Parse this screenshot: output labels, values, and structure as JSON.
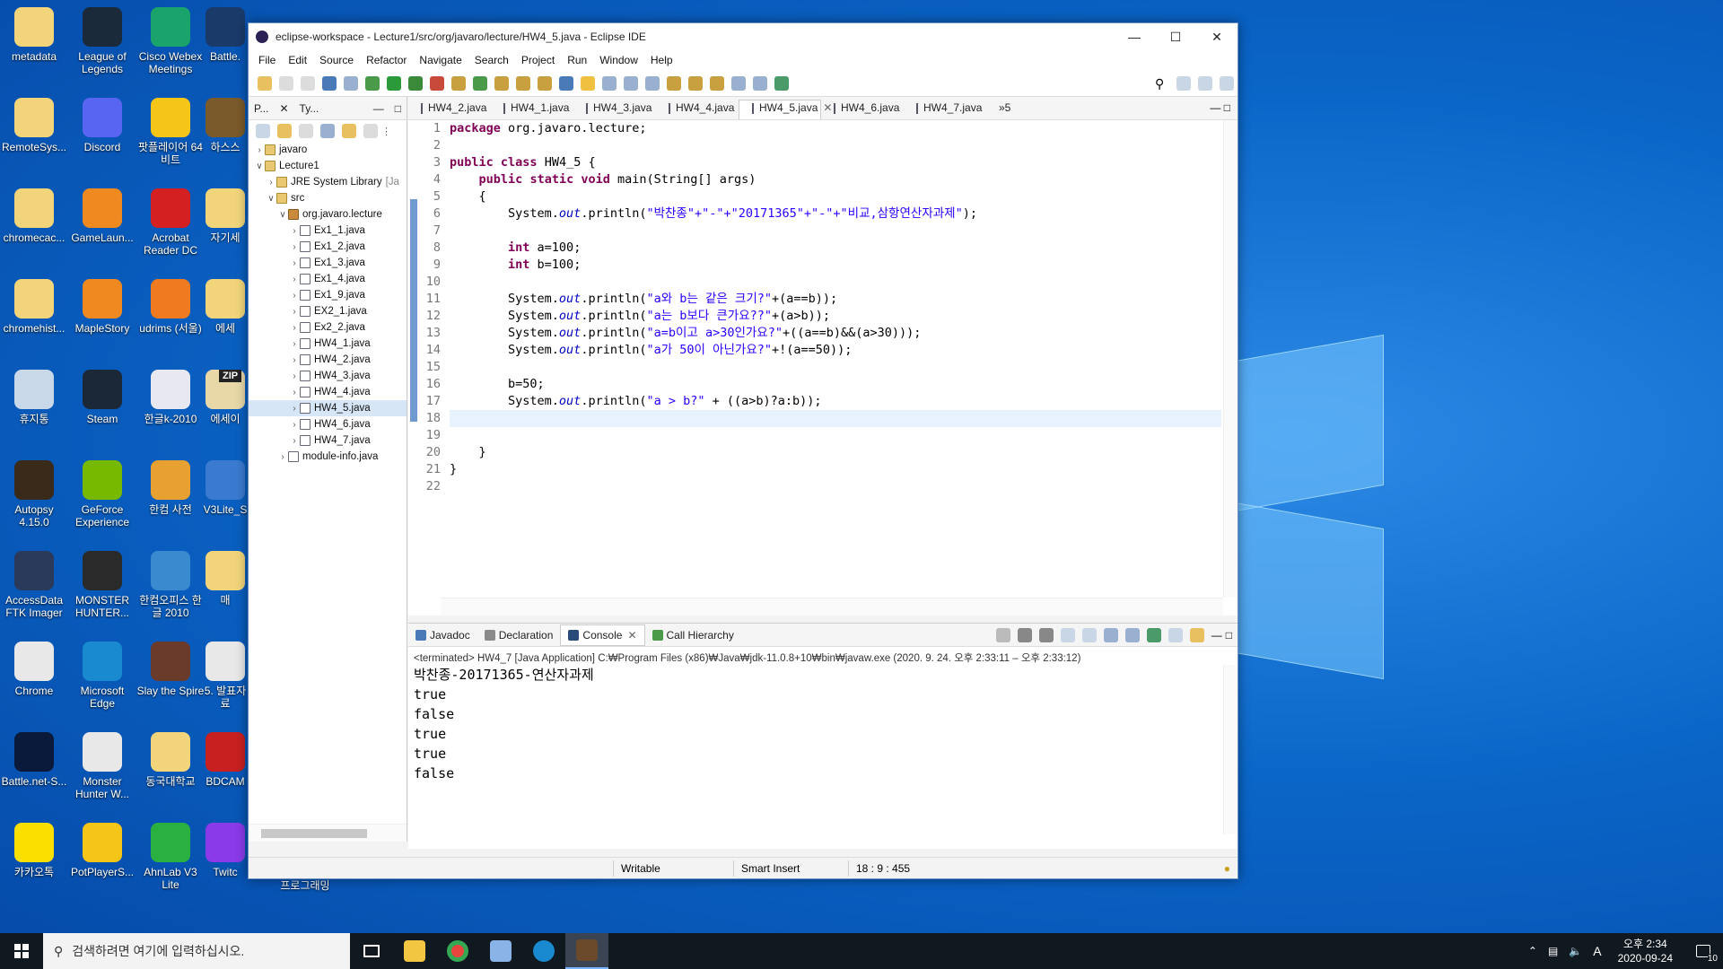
{
  "desktop": {
    "icons": [
      {
        "label": "metadata",
        "color": "#f2d57a"
      },
      {
        "label": "League of Legends",
        "color": "#1b2a3a"
      },
      {
        "label": "Cisco Webex Meetings",
        "color": "#1aa36a"
      },
      {
        "label": "Battle.",
        "color": "#1a3a6a"
      },
      {
        "label": "RemoteSys...",
        "color": "#f2d57a"
      },
      {
        "label": "Discord",
        "color": "#5865f2"
      },
      {
        "label": "팟플레이어 64 비트",
        "color": "#f5c518"
      },
      {
        "label": "하스스",
        "color": "#7a5a2a"
      },
      {
        "label": "chromecac...",
        "color": "#f2d57a"
      },
      {
        "label": "GameLaun...",
        "color": "#f08a20"
      },
      {
        "label": "Acrobat Reader DC",
        "color": "#d42020"
      },
      {
        "label": "자기세",
        "color": "#f2d57a"
      },
      {
        "label": "chromehist...",
        "color": "#f2d57a"
      },
      {
        "label": "MapleStory",
        "color": "#f08a20"
      },
      {
        "label": "udrims (서울)",
        "color": "#f07a20"
      },
      {
        "label": "에세",
        "color": "#f2d57a"
      },
      {
        "label": "휴지통",
        "color": "#c8d8e8"
      },
      {
        "label": "Steam",
        "color": "#1b2838"
      },
      {
        "label": "한글k-2010",
        "color": "#e8e8f0"
      },
      {
        "label": "에세이",
        "color": "#e8d8a8"
      },
      {
        "label": "Autopsy 4.15.0",
        "color": "#3a2a1a"
      },
      {
        "label": "GeForce Experience",
        "color": "#76b900"
      },
      {
        "label": "한컴 사전",
        "color": "#e8a030"
      },
      {
        "label": "V3Lite_S",
        "color": "#3a7ad0"
      },
      {
        "label": "AccessData FTK Imager",
        "color": "#2a3a5a"
      },
      {
        "label": "MONSTER HUNTER...",
        "color": "#2a2a2a"
      },
      {
        "label": "한컴오피스 한글 2010",
        "color": "#3a8ad0"
      },
      {
        "label": "매",
        "color": "#f2d57a"
      },
      {
        "label": "Chrome",
        "color": "#e8e8e8"
      },
      {
        "label": "Microsoft Edge",
        "color": "#1a8ad0"
      },
      {
        "label": "Slay the Spire",
        "color": "#6a3a2a"
      },
      {
        "label": "5. 발표자료",
        "color": "#e8e8e8"
      },
      {
        "label": "Battle.net-S...",
        "color": "#0a1a3a"
      },
      {
        "label": "Monster Hunter W...",
        "color": "#e8e8e8"
      },
      {
        "label": "동국대학교",
        "color": "#f2d57a"
      },
      {
        "label": "BDCAM",
        "color": "#c82020"
      },
      {
        "label": "카카오톡",
        "color": "#f9e000"
      },
      {
        "label": "PotPlayerS...",
        "color": "#f5c518"
      },
      {
        "label": "AhnLab V3 Lite",
        "color": "#2ab040"
      },
      {
        "label": "Twitc",
        "color": "#8a3ae8"
      }
    ],
    "zip_badge": "ZIP",
    "extra_label": "프로그래밍"
  },
  "window": {
    "title": "eclipse-workspace - Lecture1/src/org/javaro/lecture/HW4_5.java - Eclipse IDE",
    "menu": [
      "File",
      "Edit",
      "Source",
      "Refactor",
      "Navigate",
      "Search",
      "Project",
      "Run",
      "Window",
      "Help"
    ]
  },
  "left_pane": {
    "tabs": [
      "P...",
      "Ty..."
    ],
    "tree": [
      {
        "depth": 0,
        "arrow": ">",
        "icon": "prj",
        "label": "javaro",
        "extra": ""
      },
      {
        "depth": 0,
        "arrow": "v",
        "icon": "prj",
        "label": "Lecture1",
        "extra": ""
      },
      {
        "depth": 1,
        "arrow": ">",
        "icon": "lib",
        "label": "JRE System Library",
        "extra": "[Ja"
      },
      {
        "depth": 1,
        "arrow": "v",
        "icon": "src",
        "label": "src",
        "extra": ""
      },
      {
        "depth": 2,
        "arrow": "v",
        "icon": "pkg",
        "label": "org.javaro.lecture",
        "extra": ""
      },
      {
        "depth": 3,
        "arrow": ">",
        "icon": "java",
        "label": "Ex1_1.java",
        "extra": ""
      },
      {
        "depth": 3,
        "arrow": ">",
        "icon": "java",
        "label": "Ex1_2.java",
        "extra": ""
      },
      {
        "depth": 3,
        "arrow": ">",
        "icon": "java",
        "label": "Ex1_3.java",
        "extra": ""
      },
      {
        "depth": 3,
        "arrow": ">",
        "icon": "java",
        "label": "Ex1_4.java",
        "extra": ""
      },
      {
        "depth": 3,
        "arrow": ">",
        "icon": "java",
        "label": "Ex1_9.java",
        "extra": ""
      },
      {
        "depth": 3,
        "arrow": ">",
        "icon": "java",
        "label": "EX2_1.java",
        "extra": ""
      },
      {
        "depth": 3,
        "arrow": ">",
        "icon": "java",
        "label": "Ex2_2.java",
        "extra": ""
      },
      {
        "depth": 3,
        "arrow": ">",
        "icon": "java",
        "label": "HW4_1.java",
        "extra": ""
      },
      {
        "depth": 3,
        "arrow": ">",
        "icon": "java",
        "label": "HW4_2.java",
        "extra": ""
      },
      {
        "depth": 3,
        "arrow": ">",
        "icon": "java",
        "label": "HW4_3.java",
        "extra": ""
      },
      {
        "depth": 3,
        "arrow": ">",
        "icon": "java",
        "label": "HW4_4.java",
        "extra": ""
      },
      {
        "depth": 3,
        "arrow": ">",
        "icon": "java",
        "label": "HW4_5.java",
        "extra": "",
        "selected": true
      },
      {
        "depth": 3,
        "arrow": ">",
        "icon": "java",
        "label": "HW4_6.java",
        "extra": ""
      },
      {
        "depth": 3,
        "arrow": ">",
        "icon": "java",
        "label": "HW4_7.java",
        "extra": ""
      },
      {
        "depth": 2,
        "arrow": ">",
        "icon": "java",
        "label": "module-info.java",
        "extra": ""
      }
    ]
  },
  "editor": {
    "tabs": [
      "HW4_2.java",
      "HW4_1.java",
      "HW4_3.java",
      "HW4_4.java",
      "HW4_5.java",
      "HW4_6.java",
      "HW4_7.java"
    ],
    "active_tab": "HW4_5.java",
    "overflow": "»5",
    "current_line": 18,
    "lines": [
      [
        [
          "kw",
          "package"
        ],
        [
          "t",
          " org.javaro.lecture;"
        ]
      ],
      [],
      [
        [
          "kw",
          "public"
        ],
        [
          "t",
          " "
        ],
        [
          "kw",
          "class"
        ],
        [
          "t",
          " HW4_5 {"
        ]
      ],
      [
        [
          "t",
          "    "
        ],
        [
          "kw",
          "public"
        ],
        [
          "t",
          " "
        ],
        [
          "kw",
          "static"
        ],
        [
          "t",
          " "
        ],
        [
          "kw",
          "void"
        ],
        [
          "t",
          " main(String[] args)"
        ]
      ],
      [
        [
          "t",
          "    {"
        ]
      ],
      [
        [
          "t",
          "        System."
        ],
        [
          "fld",
          "out"
        ],
        [
          "t",
          ".println("
        ],
        [
          "st",
          "\"박찬종\"+\"-\"+\"20171365\"+\"-\"+\"비교,삼항연산자과제\""
        ],
        [
          "t",
          ");"
        ]
      ],
      [],
      [
        [
          "t",
          "        "
        ],
        [
          "kw",
          "int"
        ],
        [
          "t",
          " a=100;"
        ]
      ],
      [
        [
          "t",
          "        "
        ],
        [
          "kw",
          "int"
        ],
        [
          "t",
          " b=100;"
        ]
      ],
      [],
      [
        [
          "t",
          "        System."
        ],
        [
          "fld",
          "out"
        ],
        [
          "t",
          ".println("
        ],
        [
          "st",
          "\"a와 b는 같은 크기?\""
        ],
        [
          "t",
          "+(a==b));"
        ]
      ],
      [
        [
          "t",
          "        System."
        ],
        [
          "fld",
          "out"
        ],
        [
          "t",
          ".println("
        ],
        [
          "st",
          "\"a는 b보다 큰가요??\""
        ],
        [
          "t",
          "+(a>b));"
        ]
      ],
      [
        [
          "t",
          "        System."
        ],
        [
          "fld",
          "out"
        ],
        [
          "t",
          ".println("
        ],
        [
          "st",
          "\"a=b이고 a>30인가요?\""
        ],
        [
          "t",
          "+((a==b)&&(a>30)));"
        ]
      ],
      [
        [
          "t",
          "        System."
        ],
        [
          "fld",
          "out"
        ],
        [
          "t",
          ".println("
        ],
        [
          "st",
          "\"a가 50이 아닌가요?\""
        ],
        [
          "t",
          "+!(a==50));"
        ]
      ],
      [],
      [
        [
          "t",
          "        b=50;"
        ]
      ],
      [
        [
          "t",
          "        System."
        ],
        [
          "fld",
          "out"
        ],
        [
          "t",
          ".println("
        ],
        [
          "st",
          "\"a > b?\""
        ],
        [
          "t",
          " + ((a>b)?a:b));"
        ]
      ],
      [],
      [],
      [
        [
          "t",
          "    }"
        ]
      ],
      [
        [
          "t",
          "}"
        ]
      ],
      []
    ]
  },
  "console": {
    "tabs": [
      "Javadoc",
      "Declaration",
      "Console",
      "Call Hierarchy"
    ],
    "active_tab": "Console",
    "header": "<terminated> HW4_7 [Java Application] C:₩Program Files (x86)₩Java₩jdk-11.0.8+10₩bin₩javaw.exe  (2020. 9. 24. 오후 2:33:11 – 오후 2:33:12)",
    "output": [
      "박찬종-20171365-연산자과제",
      "true",
      "false",
      "true",
      "true",
      "false"
    ]
  },
  "statusbar": {
    "writable": "Writable",
    "insert_mode": "Smart Insert",
    "position": "18 : 9 : 455"
  },
  "taskbar": {
    "search_placeholder": "검색하려면 여기에 입력하십시오.",
    "clock_time": "오후 2:34",
    "clock_date": "2020-09-24",
    "ime": "A",
    "notification_count": "10"
  }
}
